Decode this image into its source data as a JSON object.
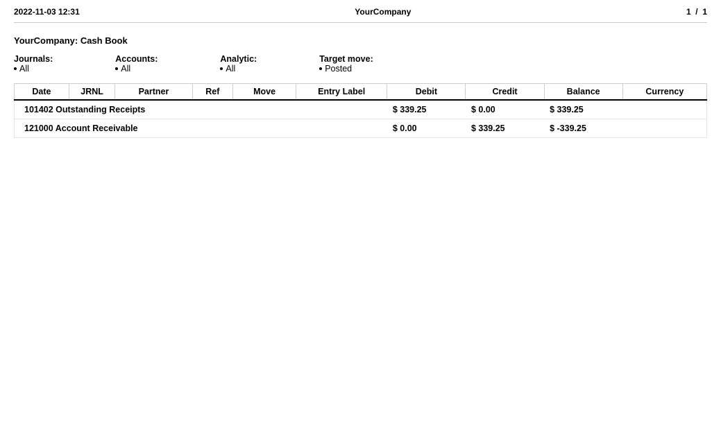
{
  "header": {
    "timestamp": "2022-11-03 12:31",
    "company": "YourCompany",
    "page_display": "1  /  1"
  },
  "report": {
    "title": "YourCompany: Cash Book"
  },
  "filters": {
    "journals_label": "Journals:",
    "journals_value": "All",
    "accounts_label": "Accounts:",
    "accounts_value": "All",
    "analytic_label": "Analytic:",
    "analytic_value": "All",
    "target_move_label": "Target move:",
    "target_move_value": "Posted"
  },
  "table": {
    "columns": {
      "date": "Date",
      "jrnl": "JRNL",
      "partner": "Partner",
      "ref": "Ref",
      "move": "Move",
      "entry_label": "Entry Label",
      "debit": "Debit",
      "credit": "Credit",
      "balance": "Balance",
      "currency": "Currency"
    },
    "rows": [
      {
        "name": "101402 Outstanding Receipts",
        "debit": "$ 339.25",
        "credit": "$ 0.00",
        "balance": "$ 339.25",
        "currency": ""
      },
      {
        "name": "121000 Account Receivable",
        "debit": "$ 0.00",
        "credit": "$ 339.25",
        "balance": "$ -339.25",
        "currency": ""
      }
    ]
  }
}
